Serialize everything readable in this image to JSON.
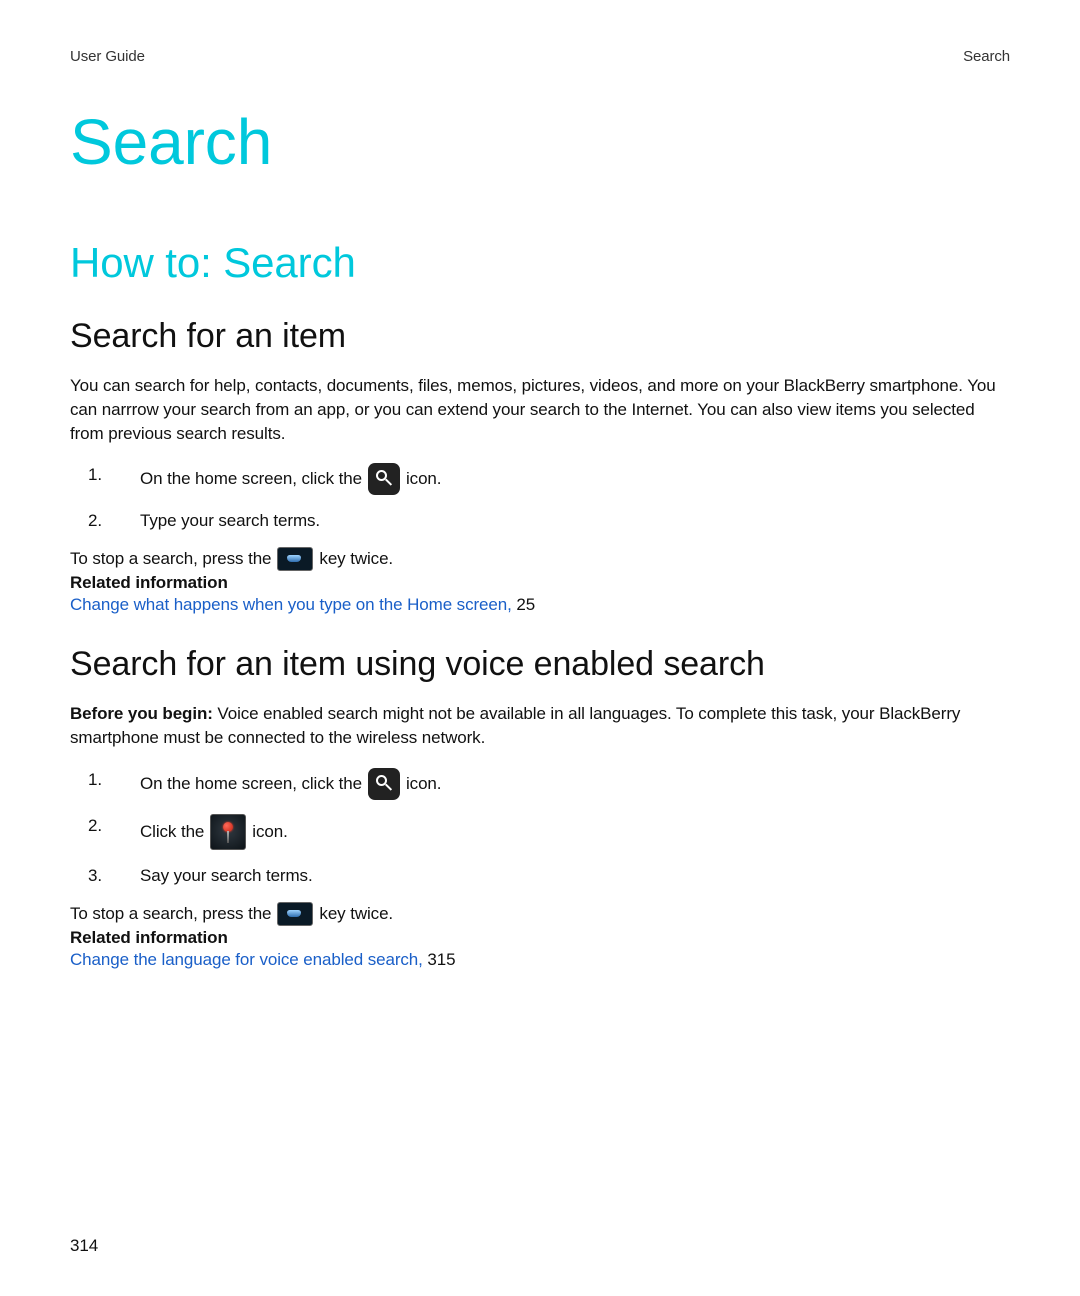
{
  "header": {
    "left": "User Guide",
    "right": "Search"
  },
  "chapter_title": "Search",
  "section_title": "How to: Search",
  "topics": [
    {
      "heading": "Search for an item",
      "intro": "You can search for help, contacts, documents, files, memos, pictures, videos, and more on your BlackBerry smartphone. You can narrrow your search from an app, or you can extend your search to the Internet. You can also view items you selected from previous search results.",
      "steps": [
        {
          "pre": "On the home screen, click the ",
          "icon": "search",
          "post": " icon."
        },
        {
          "pre": "Type your search terms.",
          "icon": null,
          "post": ""
        }
      ],
      "stop": {
        "pre": "To stop a search, press the ",
        "icon": "end",
        "post": " key twice."
      },
      "related_heading": "Related information",
      "related": {
        "text": "Change what happens when you type on the Home screen,",
        "page": "25"
      }
    },
    {
      "heading": "Search for an item using voice enabled search",
      "intro_bold_label": "Before you begin:",
      "intro": " Voice enabled search might not be available in all languages. To complete this task, your BlackBerry smartphone must be connected to the wireless network.",
      "steps": [
        {
          "pre": "On the home screen, click the ",
          "icon": "search",
          "post": " icon."
        },
        {
          "pre": "Click the ",
          "icon": "voice",
          "post": " icon."
        },
        {
          "pre": "Say your search terms.",
          "icon": null,
          "post": ""
        }
      ],
      "stop": {
        "pre": "To stop a search, press the ",
        "icon": "end",
        "post": " key twice."
      },
      "related_heading": "Related information",
      "related": {
        "text": "Change the language for voice enabled search,",
        "page": "315"
      }
    }
  ],
  "page_number": "314"
}
